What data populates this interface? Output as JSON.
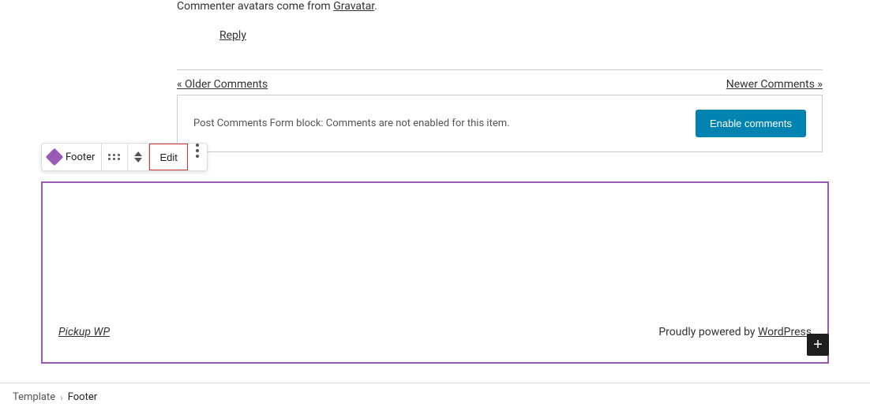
{
  "top": {
    "gravatar_text": "Commenter avatars come from",
    "gravatar_link": "Gravatar",
    "gravatar_period": ".",
    "reply_label": "Reply"
  },
  "pagination": {
    "older_comments": "« Older Comments",
    "newer_comments": "Newer Comments »"
  },
  "comments_notice": {
    "text": "Post Comments Form block: Comments are not enabled for this item.",
    "enable_button": "Enable comments"
  },
  "toolbar": {
    "block_icon": "diamond",
    "block_label": "Footer",
    "edit_label": "Edit",
    "move_tooltip": "Move",
    "options_tooltip": "Options"
  },
  "footer": {
    "site_link": "Pickup WP",
    "powered_text": "Proudly powered by",
    "wp_link": "WordPress"
  },
  "add_block": {
    "label": "+"
  },
  "breadcrumb": {
    "root": "Template",
    "separator": "›",
    "current": "Footer"
  }
}
